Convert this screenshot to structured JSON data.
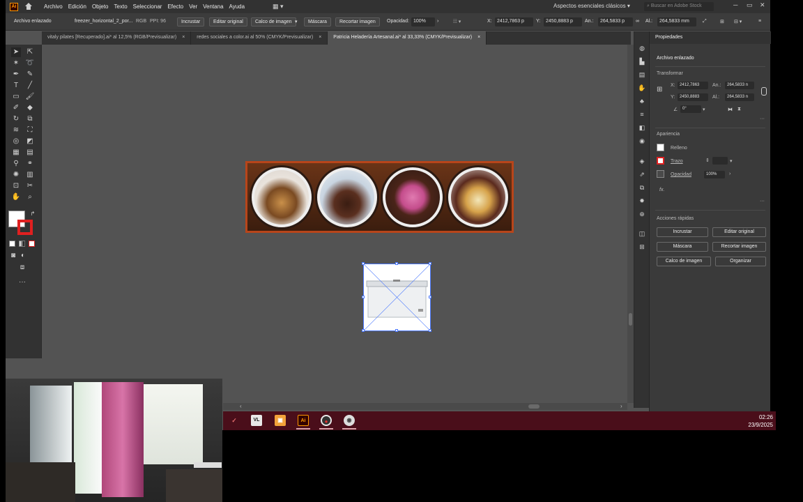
{
  "app": {
    "logo": "Ai"
  },
  "menu": [
    "Archivo",
    "Edición",
    "Objeto",
    "Texto",
    "Seleccionar",
    "Efecto",
    "Ver",
    "Ventana",
    "Ayuda"
  ],
  "workspace": "Aspectos esenciales clásicos",
  "search": {
    "placeholder": "Buscar en Adobe Stock"
  },
  "controlbar": {
    "label": "Archivo enlazado",
    "file": "freezer_horizontal_2_por...",
    "mode": "RGB",
    "ppi": "PPI: 96",
    "embed": "Incrustar",
    "edit": "Editar original",
    "trace": "Calco de imagen",
    "mask": "Máscara",
    "crop": "Recortar imagen",
    "opacity_label": "Opacidad:",
    "opacity": "100%",
    "x": "2412,7863 p",
    "y": "2450,8883 p",
    "w": "264,5833 p",
    "h": "264,5833 mm"
  },
  "tabs": [
    {
      "label": "vitaly pilates [Recuperado].ai* al 12,5% (RGB/Previsualizar)"
    },
    {
      "label": "redes sociales a color.ai al 50% (CMYK/Previsualizar)"
    },
    {
      "label": "Patricia Heladería Artesanal.ai* al 33,33% (CMYK/Previsualizar)"
    }
  ],
  "panel": {
    "title": "Propiedades",
    "subtitle": "Archivo enlazado",
    "transform_title": "Transformar",
    "x_label": "X:",
    "x": "2412,7863",
    "y_label": "Y:",
    "y": "2450,8883",
    "w_label": "An.:",
    "w": "264,5833 n",
    "h_label": "Al.:",
    "h": "264,5833 n",
    "angle": "0°",
    "appearance_title": "Apariencia",
    "fill": "Relleno",
    "stroke": "Trazo",
    "opacity_label": "Opacidad",
    "opacity": "100%",
    "fx": "fx.",
    "quick_title": "Acciones rápidas",
    "btn_embed": "Incrustar",
    "btn_edit": "Editar original",
    "btn_mask": "Máscara",
    "btn_crop": "Recortar imagen",
    "btn_trace": "Calco de imagen",
    "btn_arrange": "Organizar"
  },
  "taskbar": {
    "time": "02:26",
    "date": "23/9/2025",
    "ai_icon": "Ai",
    "vlc_icon": "VL"
  },
  "colors": {
    "accent": "#b8451a",
    "taskbar": "#4a0e1a",
    "selection": "#4a78ff"
  }
}
